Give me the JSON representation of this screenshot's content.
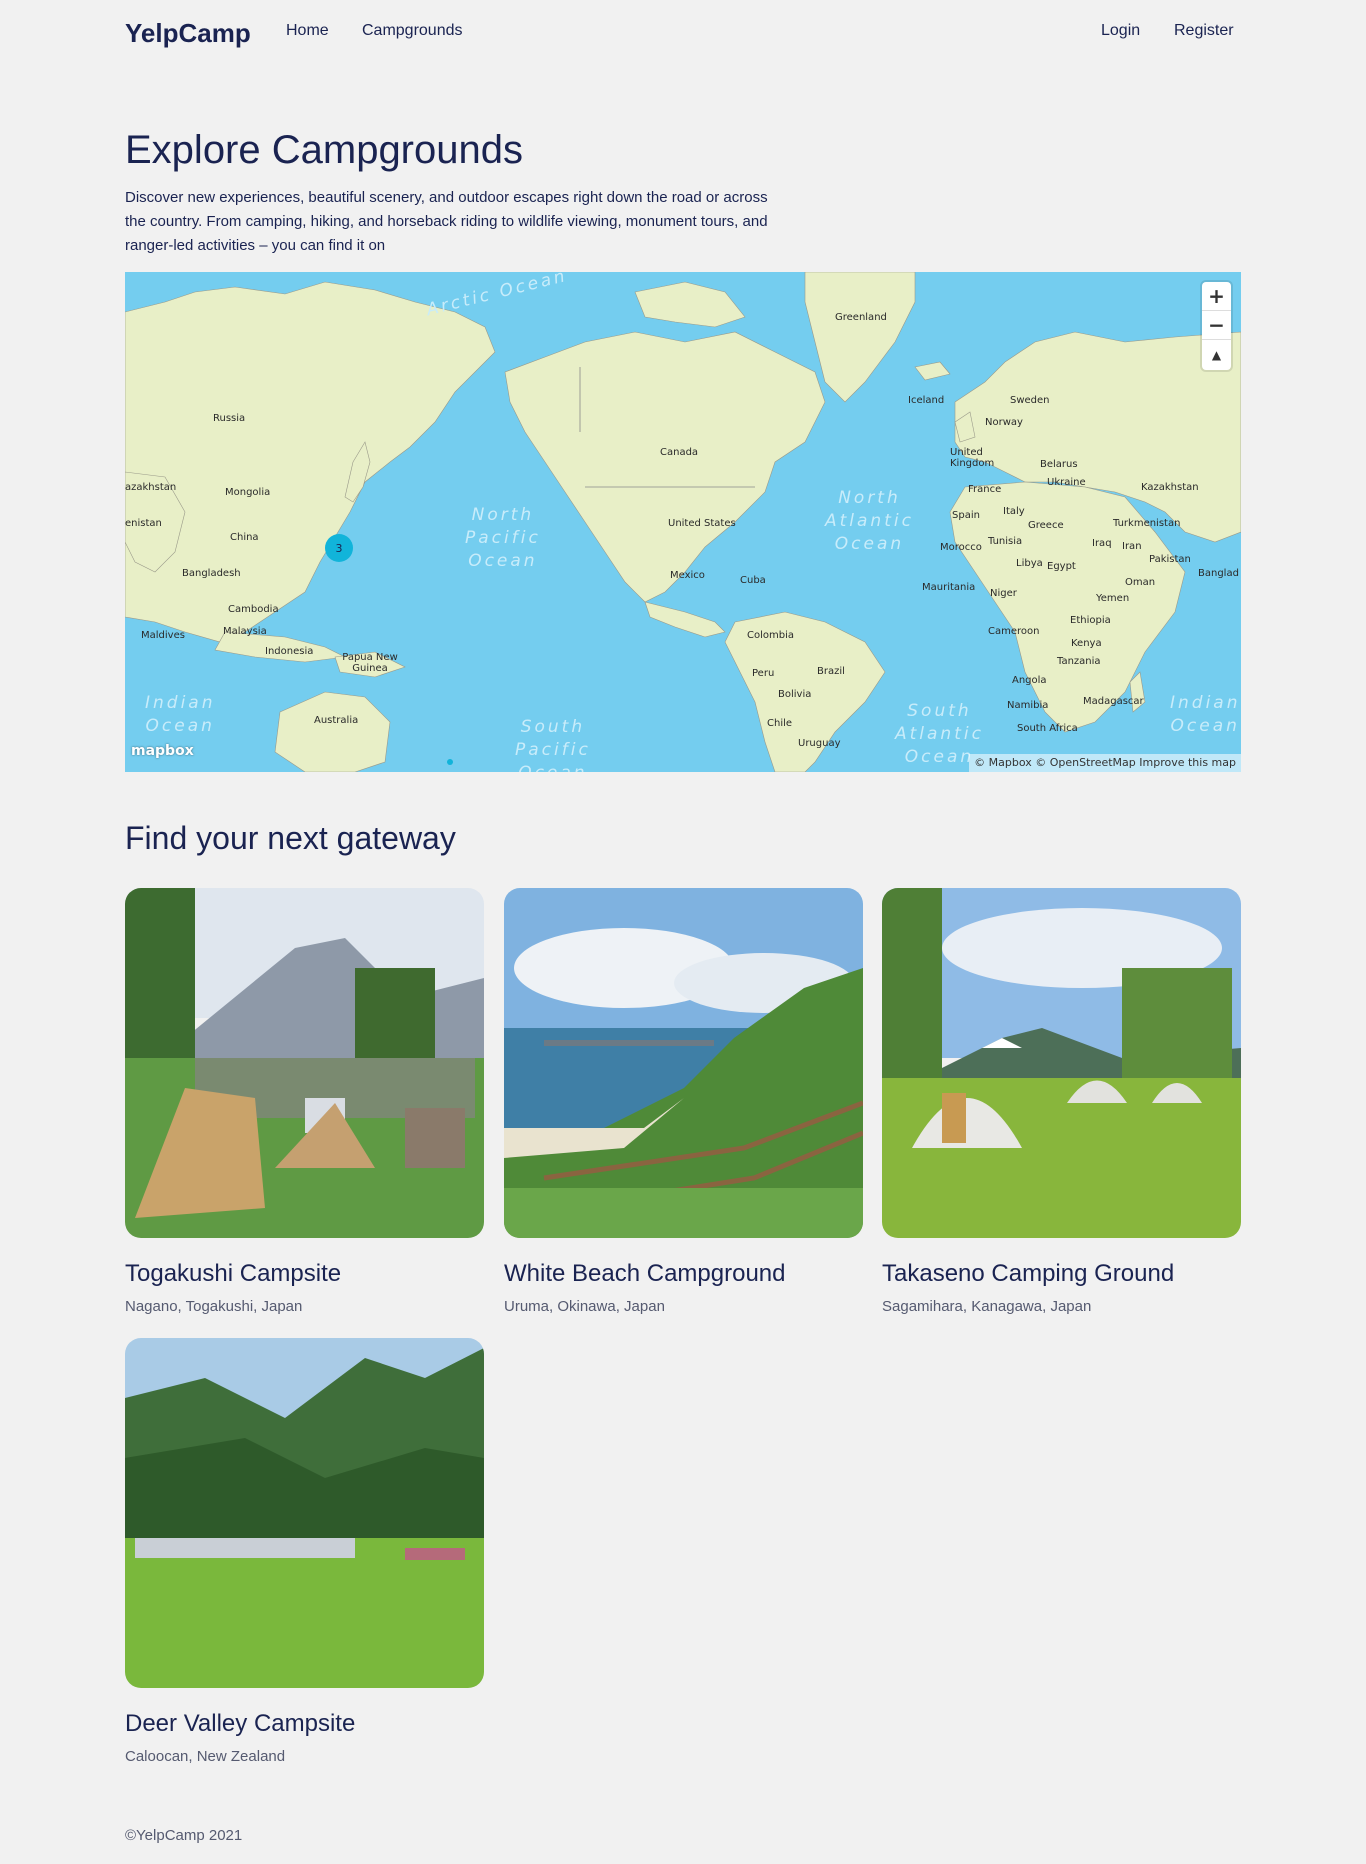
{
  "nav": {
    "brand": "YelpCamp",
    "links": [
      "Home",
      "Campgrounds"
    ],
    "login": "Login",
    "register": "Register"
  },
  "hero": {
    "title": "Explore Campgrounds",
    "description": "Discover new experiences, beautiful scenery, and outdoor escapes right down the road or across the country. From camping, hiking, and horseback riding to wildlife viewing, monument tours, and ranger-led activities – you can find it on"
  },
  "map": {
    "country_labels": [
      "Greenland",
      "Russia",
      "Iceland",
      "Sweden",
      "Norway",
      "United Kingdom",
      "Belarus",
      "Canada",
      "Mongolia",
      "Ukraine",
      "Kazakhstan",
      "France",
      "Italy",
      "Spain",
      "Greece",
      "Turkmenistan",
      "United States",
      "China",
      "Tunisia",
      "Iraq",
      "Iran",
      "Morocco",
      "Libya",
      "Egypt",
      "Pakistan",
      "Mexico",
      "Cuba",
      "Bangladesh",
      "Oman",
      "Mauritania",
      "Niger",
      "Yemen",
      "Cambodia",
      "Colombia",
      "Ethiopia",
      "Malaysia",
      "Maldives",
      "Cameroon",
      "Kenya",
      "Indonesia",
      "Papua New Guinea",
      "Brazil",
      "Peru",
      "Tanzania",
      "Angola",
      "Bolivia",
      "Madagascar",
      "Namibia",
      "Australia",
      "Chile",
      "South Africa",
      "Uruguay",
      "azakhstan",
      "enistan",
      "Banglad"
    ],
    "ocean_labels": [
      "Arctic Ocean",
      "North Pacific Ocean",
      "North Atlantic Ocean",
      "Indian Ocean",
      "South Pacific Ocean",
      "South Atlantic Ocean",
      "Indian Ocean"
    ],
    "cluster_count": "3",
    "zoom_in": "+",
    "zoom_out": "−",
    "compass": "▲",
    "logo": "mapbox",
    "attribution": "© Mapbox © OpenStreetMap Improve this map",
    "land_color": "#e8efc7",
    "water_color": "#74cdef",
    "cluster_color": "#11b4da"
  },
  "section": {
    "title": "Find your next gateway"
  },
  "campgrounds": [
    {
      "title": "Togakushi Campsite",
      "location": "Nagano, Togakushi, Japan"
    },
    {
      "title": "White Beach Campground",
      "location": "Uruma, Okinawa, Japan"
    },
    {
      "title": "Takaseno Camping Ground",
      "location": "Sagamihara, Kanagawa, Japan"
    },
    {
      "title": "Deer Valley Campsite",
      "location": "Caloocan, New Zealand"
    }
  ],
  "footer": "©YelpCamp 2021"
}
